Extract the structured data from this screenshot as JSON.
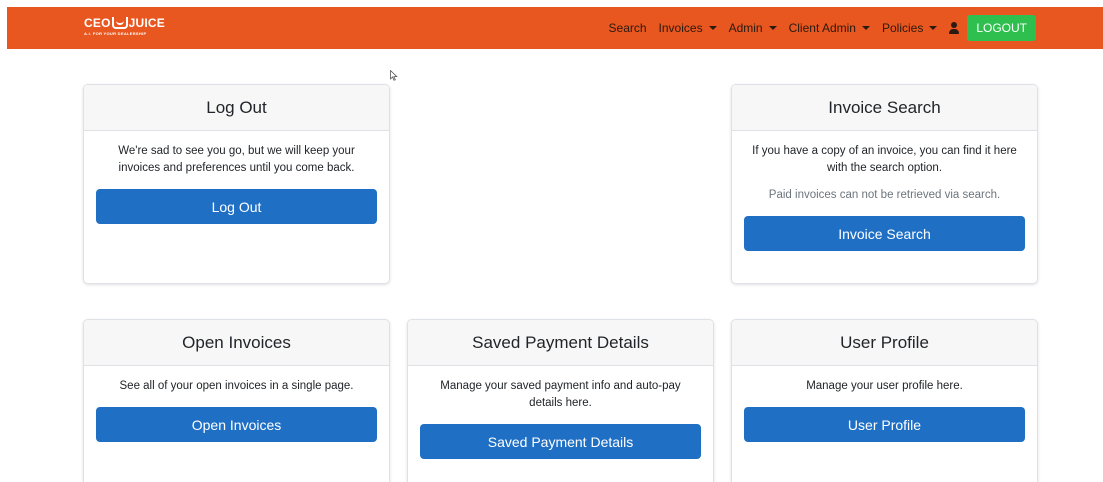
{
  "navbar": {
    "brand_main": "CEO",
    "brand_suffix": "JUICE",
    "brand_tagline": "A.I. FOR YOUR DEALERSHIP",
    "links": [
      {
        "label": "Search",
        "dropdown": false
      },
      {
        "label": "Invoices",
        "dropdown": true
      },
      {
        "label": "Admin",
        "dropdown": true
      },
      {
        "label": "Client Admin",
        "dropdown": true
      },
      {
        "label": "Policies",
        "dropdown": true
      }
    ],
    "user_icon": "user-icon",
    "logout_label": "LOGOUT",
    "bg_color": "#e8571f",
    "logout_color": "#2ebf4f"
  },
  "cards": {
    "logout": {
      "title": "Log Out",
      "text": "We're sad to see you go, but we will keep your invoices and preferences until you come back.",
      "button": "Log Out"
    },
    "invoice_search": {
      "title": "Invoice Search",
      "text": "If you have a copy of an invoice, you can find it here with the search option.",
      "note": "Paid invoices can not be retrieved via search.",
      "button": "Invoice Search"
    },
    "open_invoices": {
      "title": "Open Invoices",
      "text": "See all of your open invoices in a single page.",
      "button": "Open Invoices"
    },
    "saved_payment": {
      "title": "Saved Payment Details",
      "text": "Manage your saved payment info and auto-pay details here.",
      "button": "Saved Payment Details"
    },
    "user_profile": {
      "title": "User Profile",
      "text": "Manage your user profile here.",
      "button": "User Profile"
    }
  },
  "theme": {
    "button_color": "#1f6fc5"
  }
}
